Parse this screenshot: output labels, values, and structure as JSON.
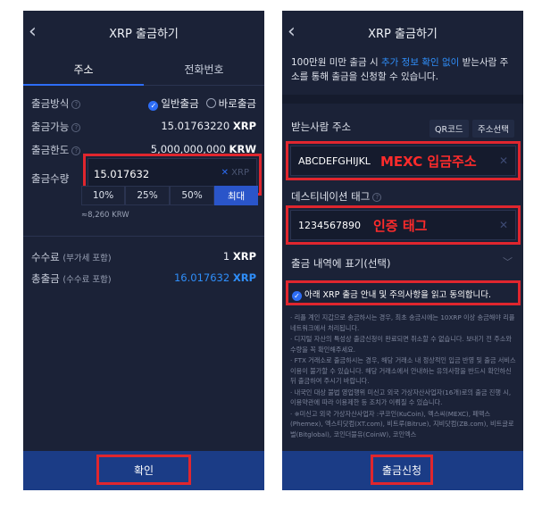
{
  "left": {
    "title": "XRP 출금하기",
    "back_icon": "chevron-left-icon",
    "tabs": [
      "주소",
      "전화번호"
    ],
    "method_label": "출금방식",
    "method_options": [
      "일반출금",
      "바로출금"
    ],
    "available_label": "출금가능",
    "available_value": "15.01763220",
    "available_unit": "XRP",
    "limit_label": "출금한도",
    "limit_value": "5,000,000,000",
    "limit_unit": "KRW",
    "qty_label": "출금수량",
    "qty_value": "15.017632",
    "qty_unit": "XRP",
    "pct_buttons": [
      "10%",
      "25%",
      "50%",
      "최대"
    ],
    "krw_estimate": "≈8,260 KRW",
    "fee_label": "수수료",
    "fee_note": "(부가세 포함)",
    "fee_value": "1",
    "fee_unit": "XRP",
    "total_label": "총출금",
    "total_note": "(수수료 포함)",
    "total_value": "16.017632",
    "total_unit": "XRP",
    "confirm_label": "확인"
  },
  "right": {
    "title": "XRP 출금하기",
    "back_icon": "chevron-left-icon",
    "notice_pre": "100만원 미만 출금 시 ",
    "notice_link": "추가 정보 확인 없이",
    "notice_post": " 받는사람 주소를 통해 출금을 신청할 수 있습니다.",
    "recipient_label": "받는사람 주소",
    "qr_label": "QR코드",
    "address_select_label": "주소선택",
    "address_value": "ABCDEFGHIJKL",
    "address_annotation": "MEXC 입금주소",
    "dest_tag_label": "데스티네이션 태그",
    "dest_tag_value": "1234567890",
    "dest_tag_annotation": "인증 태그",
    "memo_label": "출금 내역에 표기(선택)",
    "agree_label": "아래 XRP 출금 안내 및 주의사항을 읽고 동의합니다.",
    "bullets": [
      "리플 계인 지갑으로 송금하시는 경우, 최초 송금시에는 10XRP 이상 송금해야 리플 네트워크에서 처리됩니다.",
      "디지털 자산의 특성상 출금신청이 완료되면 취소할 수 없습니다. 보내기 전 주소와 수량을 꼭 확인해주세요.",
      "FTX 거래소로 출금하시는 경우, 해당 거래소 내 정상적인 입금 반영 및 출금 서비스 이용이 불가할 수 있습니다. 해당 거래소에서 안내하는 유의사항을 반드시 확인하신 뒤 출금하여 주시기 바랍니다.",
      "내국인 대상 불법 영업행위 미신고 외국 가상자산사업자(16개)로의 출금 진행 시, 이용약관에 따라 이용제한 등 조치가 이뤄질 수 있습니다.",
      "※미신고 외국 가상자산사업자 :쿠코인(KuCoin), 멕스씨(MEXC), 페맥스(Phemex), 엑스티닷컴(XT.com), 비트루(Bitrue), 지비닷컴(ZB.com), 비트글로벌(Bitglobal), 코인더블유(CoinW), 코인엑스"
    ],
    "submit_label": "출금신청"
  },
  "colors": {
    "background": "#1b2237",
    "accent_blue": "#2f8ef9",
    "highlight_red": "#e0262e",
    "bottom_bar": "#1b3c86"
  }
}
